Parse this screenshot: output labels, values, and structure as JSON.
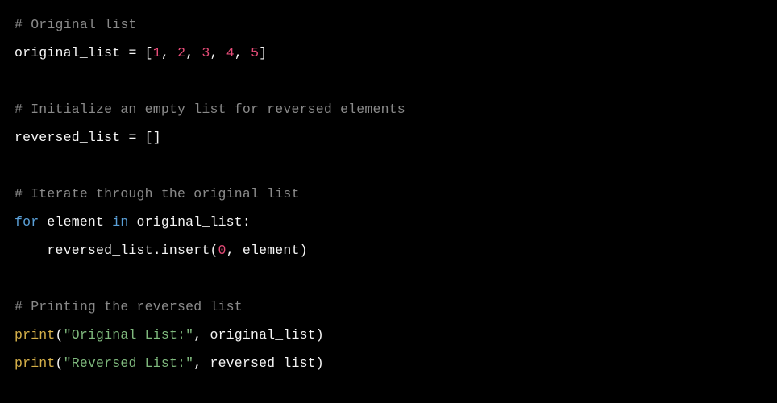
{
  "code": {
    "c1": "# Original list",
    "l2_a": "original_list ",
    "l2_b": "=",
    "l2_c": " [",
    "l2_n1": "1",
    "l2_s": ", ",
    "l2_n2": "2",
    "l2_n3": "3",
    "l2_n4": "4",
    "l2_n5": "5",
    "l2_d": "]",
    "c2": "# Initialize an empty list for reversed elements",
    "l5_a": "reversed_list ",
    "l5_b": "=",
    "l5_c": " []",
    "c3": "# Iterate through the original list",
    "l8_for": "for",
    "l8_a": " element ",
    "l8_in": "in",
    "l8_b": " original_list:",
    "l9": "    reversed_list.insert(",
    "l9_n": "0",
    "l9_b": ", element)",
    "c4": "# Printing the reversed list",
    "l12_fn": "print",
    "l12_a": "(",
    "l12_s": "\"Original List:\"",
    "l12_b": ", original_list)",
    "l13_fn": "print",
    "l13_a": "(",
    "l13_s": "\"Reversed List:\"",
    "l13_b": ", reversed_list)"
  }
}
